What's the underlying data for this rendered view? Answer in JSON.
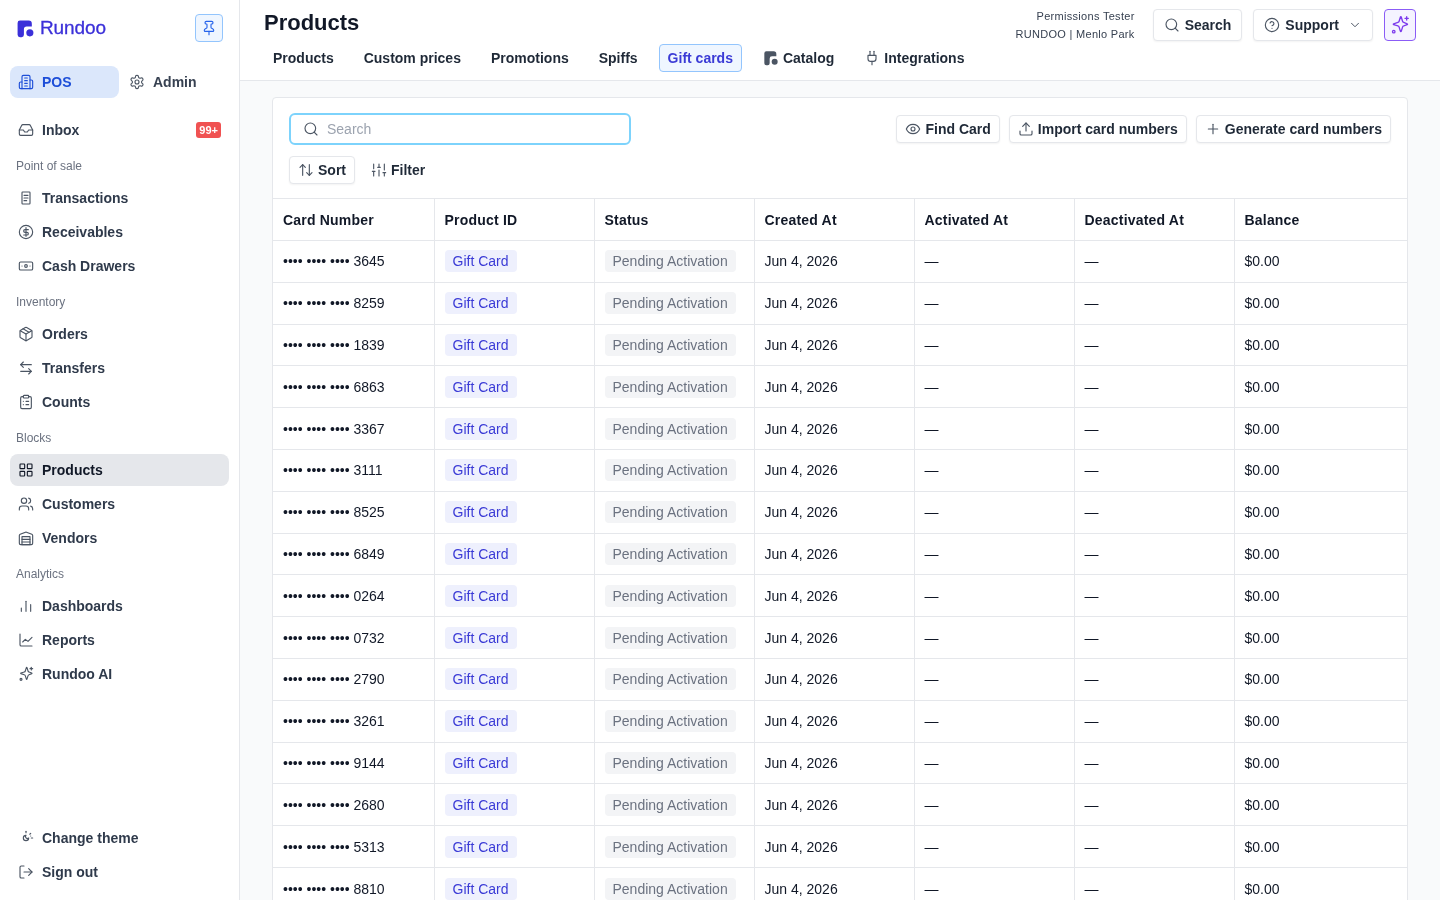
{
  "sidebar": {
    "brand": "Rundoo",
    "modes": [
      {
        "label": "POS",
        "selected": true
      },
      {
        "label": "Admin",
        "selected": false
      }
    ],
    "inbox": {
      "label": "Inbox",
      "badge": "99+",
      "selected": false
    },
    "sections": [
      {
        "title": "Point of sale",
        "items": [
          {
            "label": "Transactions",
            "selected": false
          },
          {
            "label": "Receivables",
            "selected": false
          },
          {
            "label": "Cash Drawers",
            "selected": false
          }
        ]
      },
      {
        "title": "Inventory",
        "items": [
          {
            "label": "Orders",
            "selected": false
          },
          {
            "label": "Transfers",
            "selected": false
          },
          {
            "label": "Counts",
            "selected": false
          }
        ]
      },
      {
        "title": "Blocks",
        "items": [
          {
            "label": "Products",
            "selected": true
          },
          {
            "label": "Customers",
            "selected": false
          },
          {
            "label": "Vendors",
            "selected": false
          }
        ]
      },
      {
        "title": "Analytics",
        "items": [
          {
            "label": "Dashboards",
            "selected": false
          },
          {
            "label": "Reports",
            "selected": false
          },
          {
            "label": "Rundoo AI",
            "selected": false
          }
        ]
      }
    ],
    "footer": [
      {
        "label": "Change theme"
      },
      {
        "label": "Sign out"
      }
    ]
  },
  "header": {
    "title": "Products",
    "tabs": [
      {
        "label": "Products",
        "selected": false
      },
      {
        "label": "Custom prices",
        "selected": false
      },
      {
        "label": "Promotions",
        "selected": false
      },
      {
        "label": "Spiffs",
        "selected": false
      },
      {
        "label": "Gift cards",
        "selected": true
      },
      {
        "label": "Catalog",
        "selected": false
      },
      {
        "label": "Integrations",
        "selected": false
      }
    ],
    "user": {
      "name": "Permissions Tester",
      "store": "RUNDOO | Menlo Park"
    },
    "search_button": "Search",
    "support_button": "Support"
  },
  "toolbar": {
    "search": {
      "placeholder": "Search",
      "focused": true
    },
    "actions": [
      {
        "label": "Find Card"
      },
      {
        "label": "Import card numbers"
      },
      {
        "label": "Generate card numbers"
      }
    ],
    "sort": "Sort",
    "filter": "Filter"
  },
  "table": {
    "columns": [
      {
        "label": "Card Number",
        "kind": "text"
      },
      {
        "label": "Product ID",
        "kind": "product"
      },
      {
        "label": "Status",
        "kind": "status"
      },
      {
        "label": "Created At",
        "kind": "text"
      },
      {
        "label": "Activated At",
        "kind": "text"
      },
      {
        "label": "Deactivated At",
        "kind": "text"
      },
      {
        "label": "Balance",
        "kind": "text"
      }
    ],
    "rows": [
      {
        "cells": [
          "•••• •••• •••• 3645",
          "Gift Card",
          "Pending Activation",
          "Jun 4, 2026",
          "—",
          "—",
          "$0.00"
        ]
      },
      {
        "cells": [
          "•••• •••• •••• 8259",
          "Gift Card",
          "Pending Activation",
          "Jun 4, 2026",
          "—",
          "—",
          "$0.00"
        ]
      },
      {
        "cells": [
          "•••• •••• •••• 1839",
          "Gift Card",
          "Pending Activation",
          "Jun 4, 2026",
          "—",
          "—",
          "$0.00"
        ]
      },
      {
        "cells": [
          "•••• •••• •••• 6863",
          "Gift Card",
          "Pending Activation",
          "Jun 4, 2026",
          "—",
          "—",
          "$0.00"
        ]
      },
      {
        "cells": [
          "•••• •••• •••• 3367",
          "Gift Card",
          "Pending Activation",
          "Jun 4, 2026",
          "—",
          "—",
          "$0.00"
        ]
      },
      {
        "cells": [
          "•••• •••• •••• 3111",
          "Gift Card",
          "Pending Activation",
          "Jun 4, 2026",
          "—",
          "—",
          "$0.00"
        ]
      },
      {
        "cells": [
          "•••• •••• •••• 8525",
          "Gift Card",
          "Pending Activation",
          "Jun 4, 2026",
          "—",
          "—",
          "$0.00"
        ]
      },
      {
        "cells": [
          "•••• •••• •••• 6849",
          "Gift Card",
          "Pending Activation",
          "Jun 4, 2026",
          "—",
          "—",
          "$0.00"
        ]
      },
      {
        "cells": [
          "•••• •••• •••• 0264",
          "Gift Card",
          "Pending Activation",
          "Jun 4, 2026",
          "—",
          "—",
          "$0.00"
        ]
      },
      {
        "cells": [
          "•••• •••• •••• 0732",
          "Gift Card",
          "Pending Activation",
          "Jun 4, 2026",
          "—",
          "—",
          "$0.00"
        ]
      },
      {
        "cells": [
          "•••• •••• •••• 2790",
          "Gift Card",
          "Pending Activation",
          "Jun 4, 2026",
          "—",
          "—",
          "$0.00"
        ]
      },
      {
        "cells": [
          "•••• •••• •••• 3261",
          "Gift Card",
          "Pending Activation",
          "Jun 4, 2026",
          "—",
          "—",
          "$0.00"
        ]
      },
      {
        "cells": [
          "•••• •••• •••• 9144",
          "Gift Card",
          "Pending Activation",
          "Jun 4, 2026",
          "—",
          "—",
          "$0.00"
        ]
      },
      {
        "cells": [
          "•••• •••• •••• 2680",
          "Gift Card",
          "Pending Activation",
          "Jun 4, 2026",
          "—",
          "—",
          "$0.00"
        ]
      },
      {
        "cells": [
          "•••• •••• •••• 5313",
          "Gift Card",
          "Pending Activation",
          "Jun 4, 2026",
          "—",
          "—",
          "$0.00"
        ]
      },
      {
        "cells": [
          "•••• •••• •••• 8810",
          "Gift Card",
          "Pending Activation",
          "Jun 4, 2026",
          "—",
          "—",
          "$0.00"
        ]
      }
    ]
  }
}
